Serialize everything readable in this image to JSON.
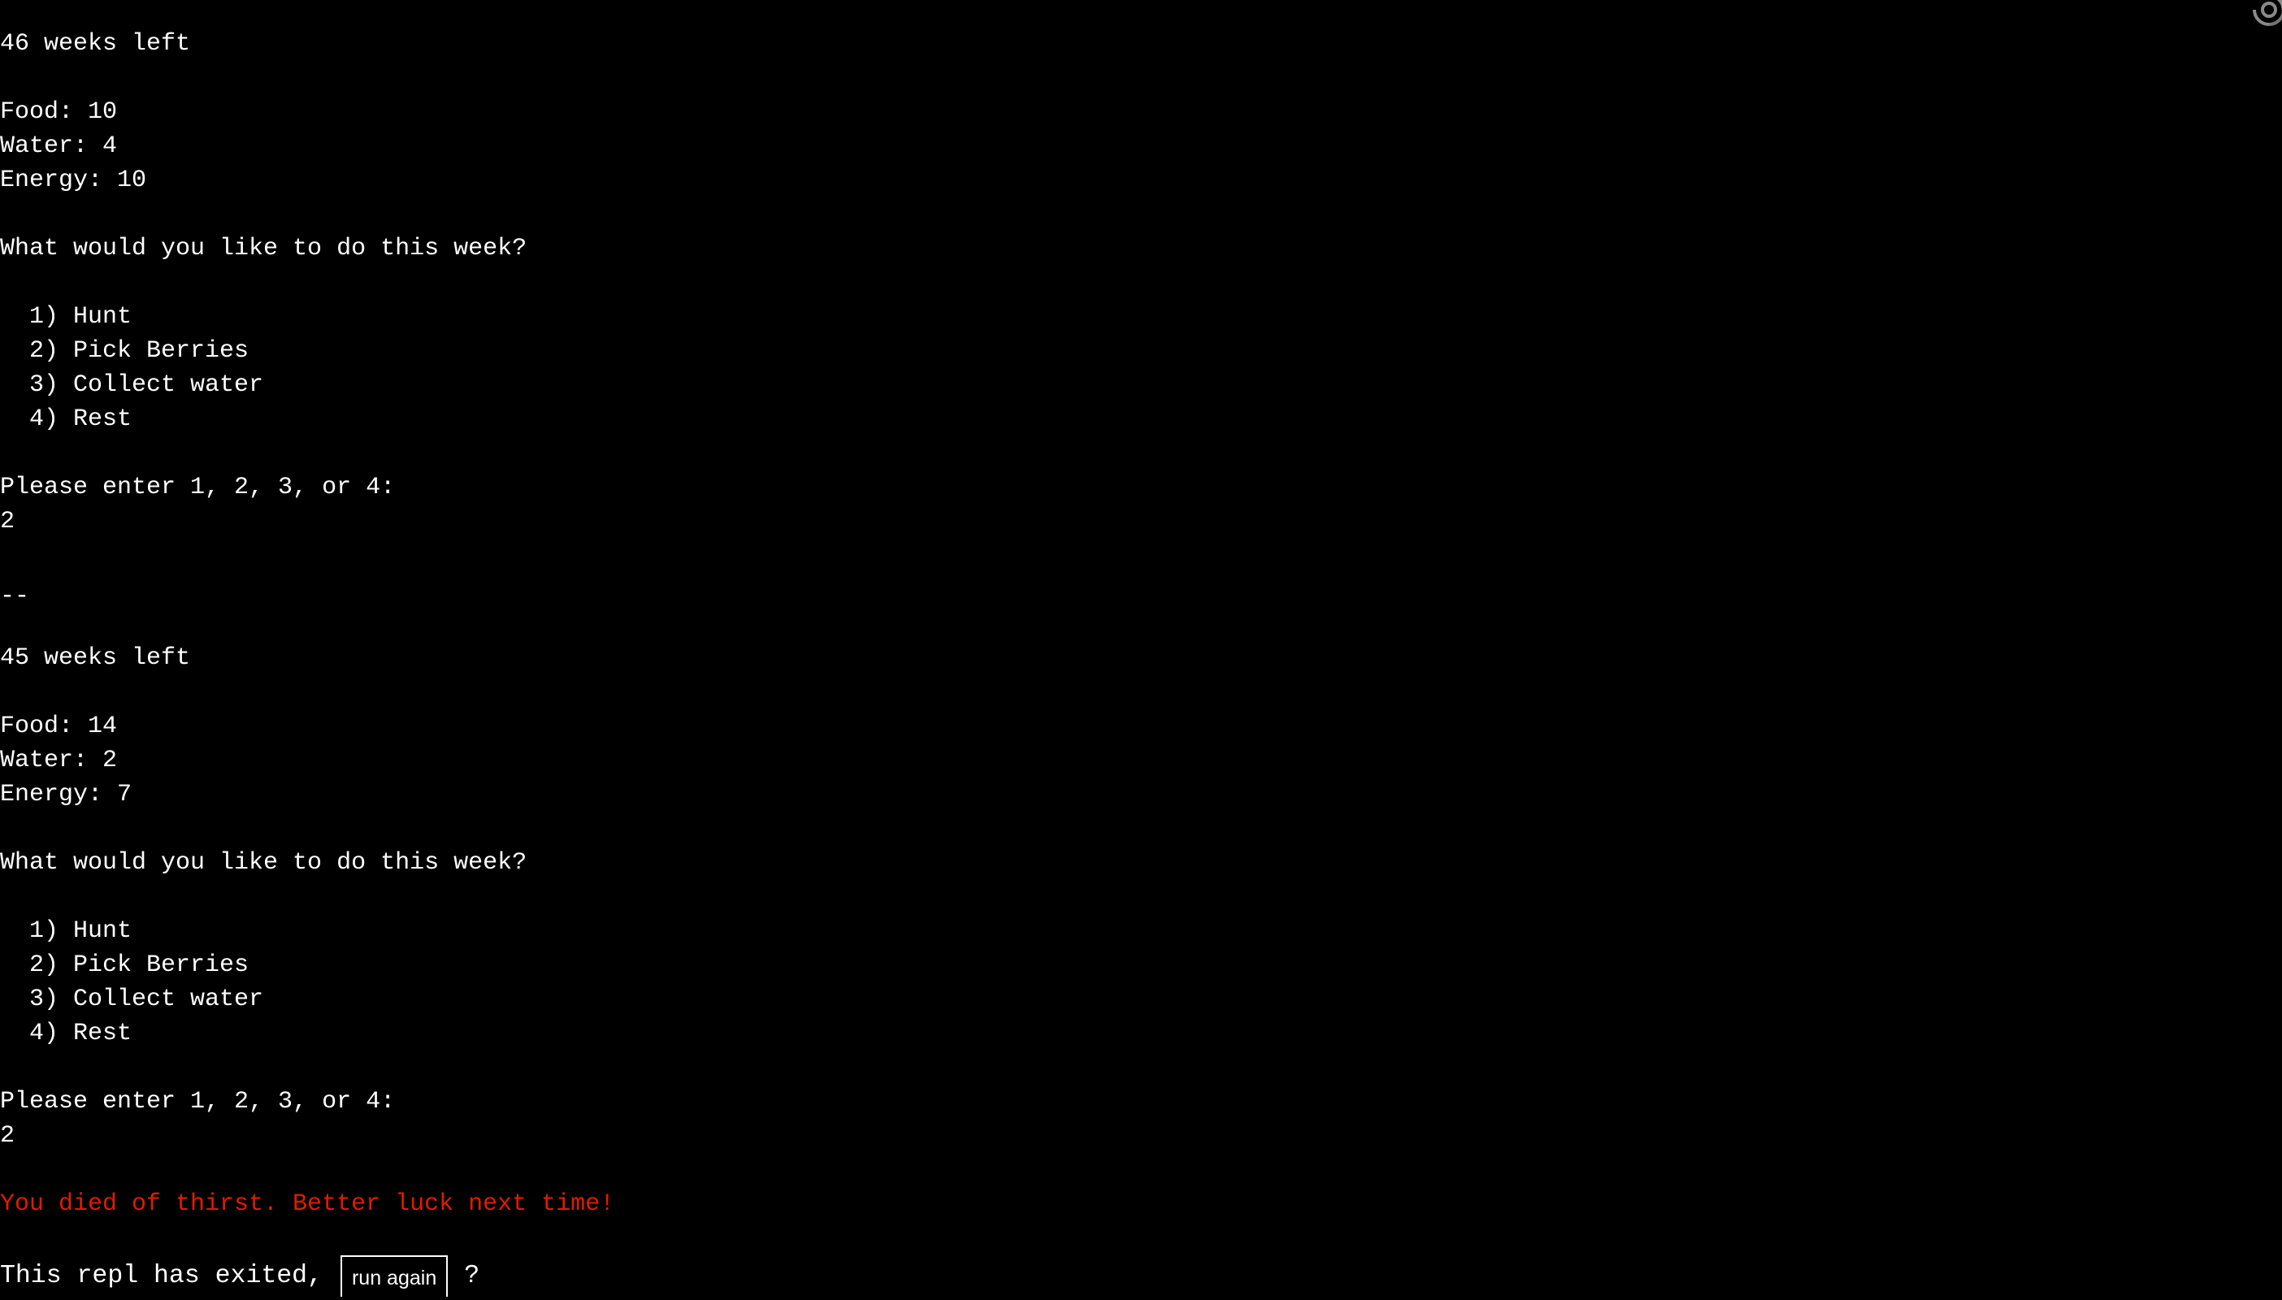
{
  "terminal": {
    "lines": [
      {
        "row": 0,
        "text": "46 weeks left",
        "kind": "status"
      },
      {
        "row": 2,
        "text": "Food: 10",
        "kind": "stat"
      },
      {
        "row": 3,
        "text": "Water: 4",
        "kind": "stat"
      },
      {
        "row": 4,
        "text": "Energy: 10",
        "kind": "stat"
      },
      {
        "row": 6,
        "text": "What would you like to do this week?",
        "kind": "prompt"
      },
      {
        "row": 8,
        "text": "  1) Hunt",
        "kind": "option"
      },
      {
        "row": 9,
        "text": "  2) Pick Berries",
        "kind": "option"
      },
      {
        "row": 10,
        "text": "  3) Collect water",
        "kind": "option"
      },
      {
        "row": 11,
        "text": "  4) Rest",
        "kind": "option"
      },
      {
        "row": 13,
        "text": "Please enter 1, 2, 3, or 4:",
        "kind": "prompt"
      },
      {
        "row": 14,
        "text": "2",
        "kind": "input"
      },
      {
        "row": 16,
        "text": "--",
        "kind": "separator"
      },
      {
        "row": 18,
        "text": "45 weeks left",
        "kind": "status"
      },
      {
        "row": 20,
        "text": "Food: 14",
        "kind": "stat"
      },
      {
        "row": 21,
        "text": "Water: 2",
        "kind": "stat"
      },
      {
        "row": 22,
        "text": "Energy: 7",
        "kind": "stat"
      },
      {
        "row": 24,
        "text": "What would you like to do this week?",
        "kind": "prompt"
      },
      {
        "row": 26,
        "text": "  1) Hunt",
        "kind": "option"
      },
      {
        "row": 27,
        "text": "  2) Pick Berries",
        "kind": "option"
      },
      {
        "row": 28,
        "text": "  3) Collect water",
        "kind": "option"
      },
      {
        "row": 29,
        "text": "  4) Rest",
        "kind": "option"
      },
      {
        "row": 31,
        "text": "Please enter 1, 2, 3, or 4:",
        "kind": "prompt"
      },
      {
        "row": 32,
        "text": "2",
        "kind": "input"
      },
      {
        "row": 34,
        "text": "You died of thirst. Better luck next time!",
        "kind": "error"
      }
    ]
  },
  "exit_bar": {
    "prefix": "This repl has exited,",
    "run_again_label": "run again",
    "suffix": "?"
  },
  "icons": {
    "top_right": "spinner-swirl-icon"
  },
  "colors": {
    "background": "#000000",
    "text": "#ffffff",
    "error": "#e01b00",
    "icon": "#8a8a8a"
  }
}
